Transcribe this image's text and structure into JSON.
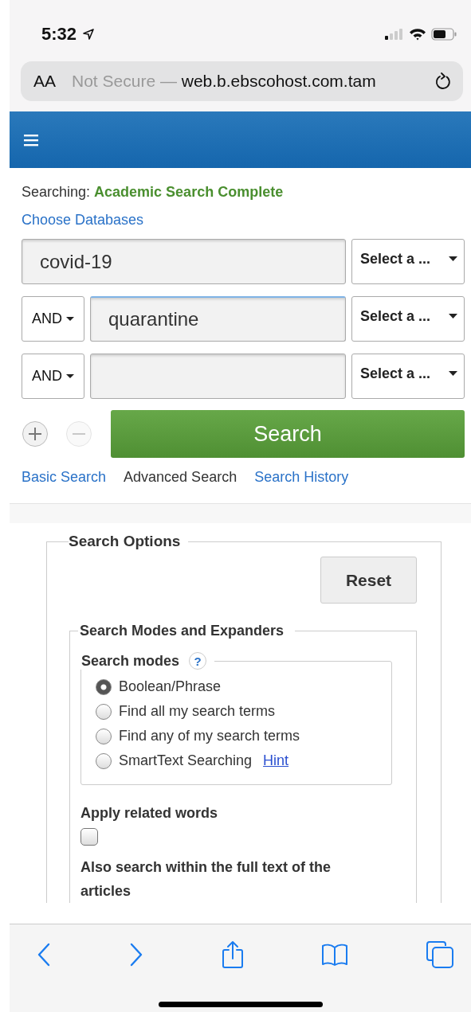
{
  "status_bar": {
    "time": "5:32"
  },
  "address_bar": {
    "text_size": "AA",
    "security": "Not Secure —",
    "url": "web.b.ebscohost.com.tam"
  },
  "searching": {
    "label": "Searching:",
    "database": "Academic Search Complete"
  },
  "choose_databases": "Choose Databases",
  "search_rows": [
    {
      "value": "covid-19",
      "field": "Select a ...",
      "focused": false
    },
    {
      "operator": "AND",
      "value": "quarantine",
      "field": "Select a ...",
      "focused": true
    },
    {
      "operator": "AND",
      "field": "Select a ...",
      "focused": false
    }
  ],
  "add_row": {
    "disabled": false
  },
  "remove_row": {
    "disabled": true
  },
  "search_button": "Search",
  "nav_links": [
    {
      "label": "Basic Search",
      "selected": false
    },
    {
      "label": "Advanced Search",
      "selected": true
    },
    {
      "label": "Search History",
      "selected": false
    }
  ],
  "search_options": {
    "title": "Search Options",
    "reset": "Reset",
    "modes_expanders": {
      "title": "Search Modes and Expanders",
      "search_modes": {
        "title": "Search modes",
        "help": "?",
        "options": [
          {
            "label": "Boolean/Phrase",
            "selected": true
          },
          {
            "label": "Find all my search terms",
            "selected": false
          },
          {
            "label": "Find any of my search terms",
            "selected": false
          },
          {
            "label": "SmartText Searching",
            "selected": false,
            "link": "Hint"
          }
        ]
      },
      "related_words": {
        "label": "Apply related words",
        "checked": false
      },
      "full_text": {
        "label": "Also search within the full text of the articles"
      }
    }
  }
}
